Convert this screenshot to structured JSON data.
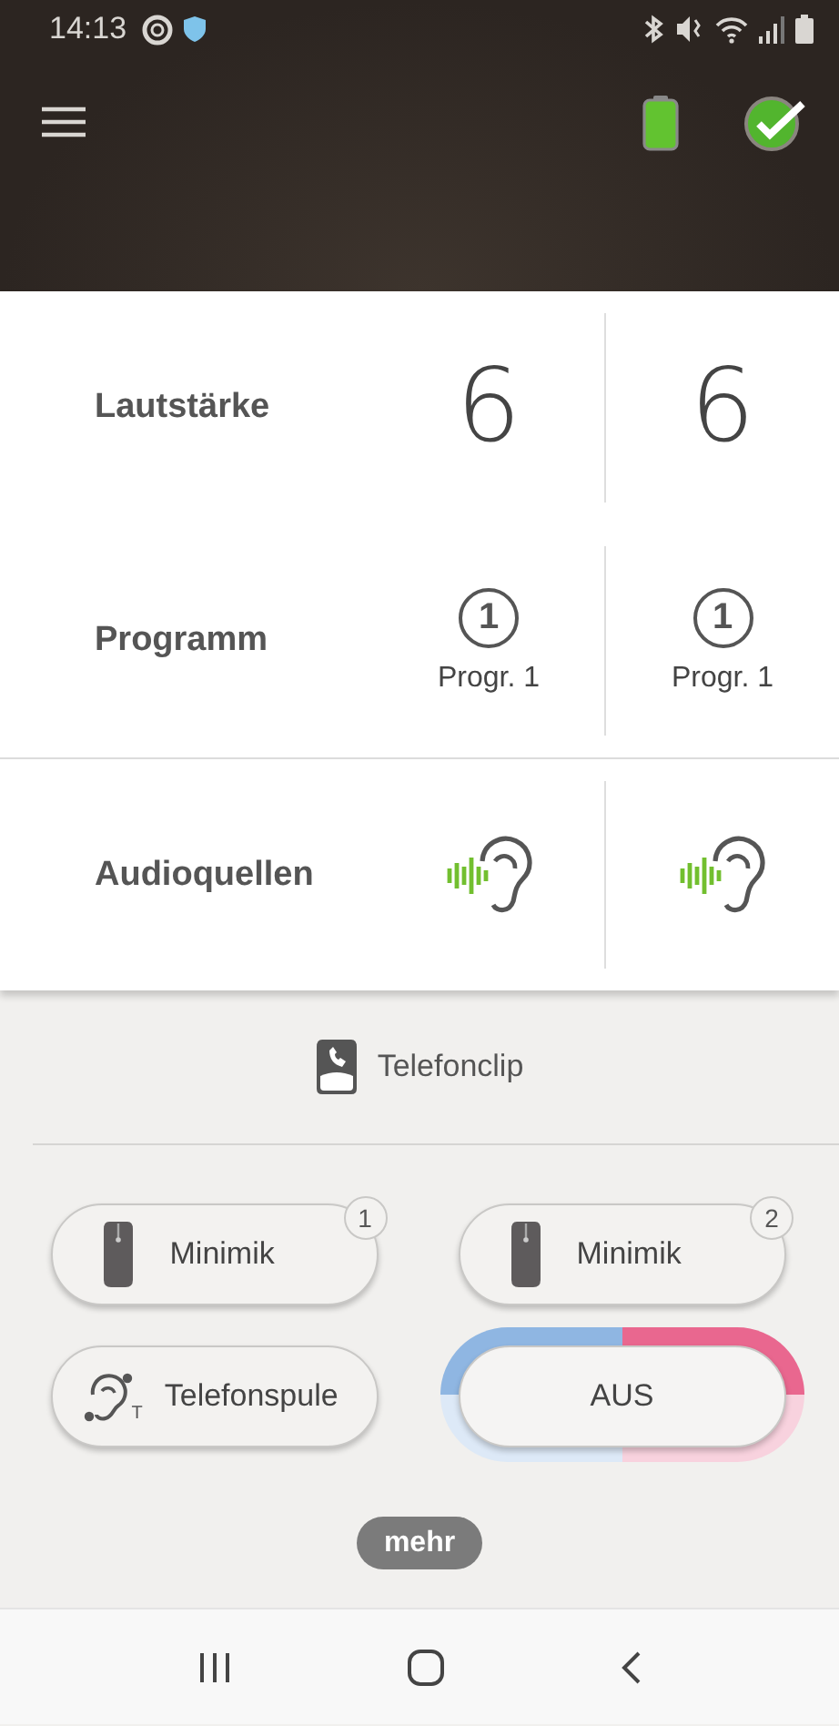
{
  "status_bar": {
    "time": "14:13"
  },
  "rows": [
    {
      "label": "Lautstärke",
      "kind": "number",
      "cells": [
        {
          "value": "6"
        },
        {
          "value": "6"
        }
      ]
    },
    {
      "label": "Programm",
      "kind": "program",
      "cells": [
        {
          "value": "1",
          "caption": "Progr. 1"
        },
        {
          "value": "1",
          "caption": "Progr. 1"
        }
      ]
    },
    {
      "label": "Audioquellen",
      "kind": "audio",
      "cells": [
        {},
        {}
      ]
    }
  ],
  "current_source": {
    "label": "Telefonclip"
  },
  "sources": [
    {
      "label": "Minimik",
      "badge": "1",
      "kind": "mic",
      "selected": false
    },
    {
      "label": "Minimik",
      "badge": "2",
      "kind": "mic",
      "selected": false
    },
    {
      "label": "Telefonspule",
      "icon_letter": "T",
      "kind": "telecoil",
      "selected": false
    },
    {
      "label": "AUS",
      "kind": "off",
      "selected": true
    }
  ],
  "more_button": "mehr"
}
